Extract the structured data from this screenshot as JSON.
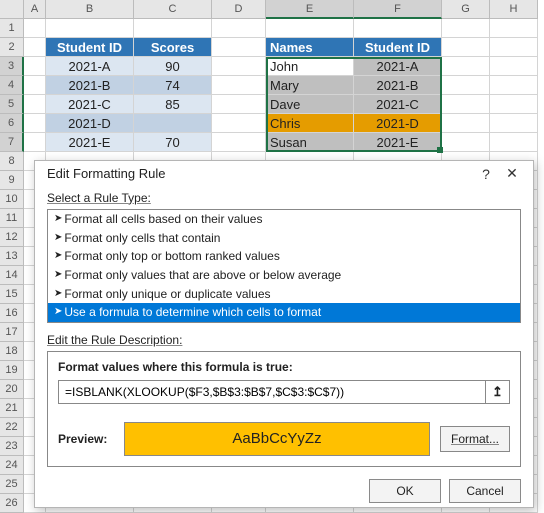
{
  "columns": [
    "A",
    "B",
    "C",
    "D",
    "E",
    "F",
    "G",
    "H"
  ],
  "rows": [
    "1",
    "2",
    "3",
    "4",
    "5",
    "6",
    "7",
    "8",
    "9",
    "10",
    "11",
    "12",
    "13",
    "14",
    "15",
    "16",
    "17",
    "18",
    "19",
    "20",
    "21",
    "22",
    "23",
    "24",
    "25",
    "26"
  ],
  "table1": {
    "headers": [
      "Student ID",
      "Scores"
    ],
    "rows": [
      {
        "id": "2021-A",
        "score": "90"
      },
      {
        "id": "2021-B",
        "score": "74"
      },
      {
        "id": "2021-C",
        "score": "85"
      },
      {
        "id": "2021-D",
        "score": ""
      },
      {
        "id": "2021-E",
        "score": "70"
      }
    ]
  },
  "table2": {
    "headers": [
      "Names",
      "Student ID"
    ],
    "rows": [
      {
        "name": "John",
        "id": "2021-A"
      },
      {
        "name": "Mary",
        "id": "2021-B"
      },
      {
        "name": "Dave",
        "id": "2021-C"
      },
      {
        "name": "Chris",
        "id": "2021-D"
      },
      {
        "name": "Susan",
        "id": "2021-E"
      }
    ]
  },
  "dialog": {
    "title": "Edit Formatting Rule",
    "help": "?",
    "close": "✕",
    "select_label": "Select a Rule Type:",
    "rule_types": [
      "Format all cells based on their values",
      "Format only cells that contain",
      "Format only top or bottom ranked values",
      "Format only values that are above or below average",
      "Format only unique or duplicate values",
      "Use a formula to determine which cells to format"
    ],
    "selected_rule_index": 5,
    "edit_label": "Edit the Rule Description:",
    "formula_label": "Format values where this formula is true:",
    "formula_value": "=ISBLANK(XLOOKUP($F3,$B$3:$B$7,$C$3:$C$7))",
    "preview_label": "Preview:",
    "preview_text": "AaBbCcYyZz",
    "format_btn": "Format...",
    "ok": "OK",
    "cancel": "Cancel"
  },
  "colors": {
    "header_blue": "#2f75b5",
    "gold": "#ffc000",
    "gold_cell": "#e59c00",
    "selection_green": "#1f7246",
    "blue_selected_row": "#0078d7"
  }
}
